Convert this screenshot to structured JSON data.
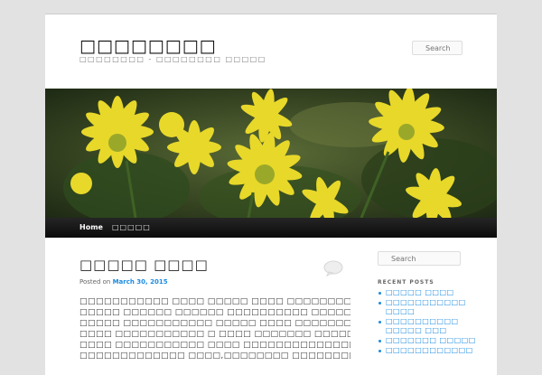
{
  "site": {
    "title": "□□□□□□□□",
    "description": "□□□□□□□□ - □□□□□□□□ □□□□□"
  },
  "search": {
    "placeholder_top": "Search",
    "placeholder_side": "Search"
  },
  "nav": {
    "home": "Home",
    "item": "□□□□□"
  },
  "post": {
    "title": "□□□□□ □□□□",
    "posted_on": "Posted on",
    "date": "March 30, 2015",
    "lines": [
      "□□□□□□□□□□□ □□□□ □□□□□ □□□□ □□□□□□□□□□□",
      "□□□□□ □□□□□□ □□□□□□ □□□□□□□□□□ □□□□□□□□□",
      "□□□□□ □□□□□□□□□□□ □□□□□ □□□□ □□□□□□□□□□",
      "□□□□ □□□□□□□□□□□ □ □□□□ □□□□□□□ □□□□□□",
      "□□□□ □□□□□□□□□□□ □□□□ □□□□□□□□□□□□□□□□□",
      "□□□□□□□□□□□□□ □□□□,□□□□□□□□ □□□□□□□□□ □□□"
    ]
  },
  "sidebar": {
    "recent_title": "RECENT POSTS",
    "recent": [
      "□□□□□ □□□□",
      "□□□□□□□□□□□ □□□□",
      "□□□□□□□□□□ □□□□□ □□□",
      "□□□□□□□ □□□□□",
      "□□□□□□□□□□□□"
    ]
  },
  "colors": {
    "link": "#1b8be0",
    "nav_bg": "#111111",
    "page_bg": "#e2e2e2"
  }
}
